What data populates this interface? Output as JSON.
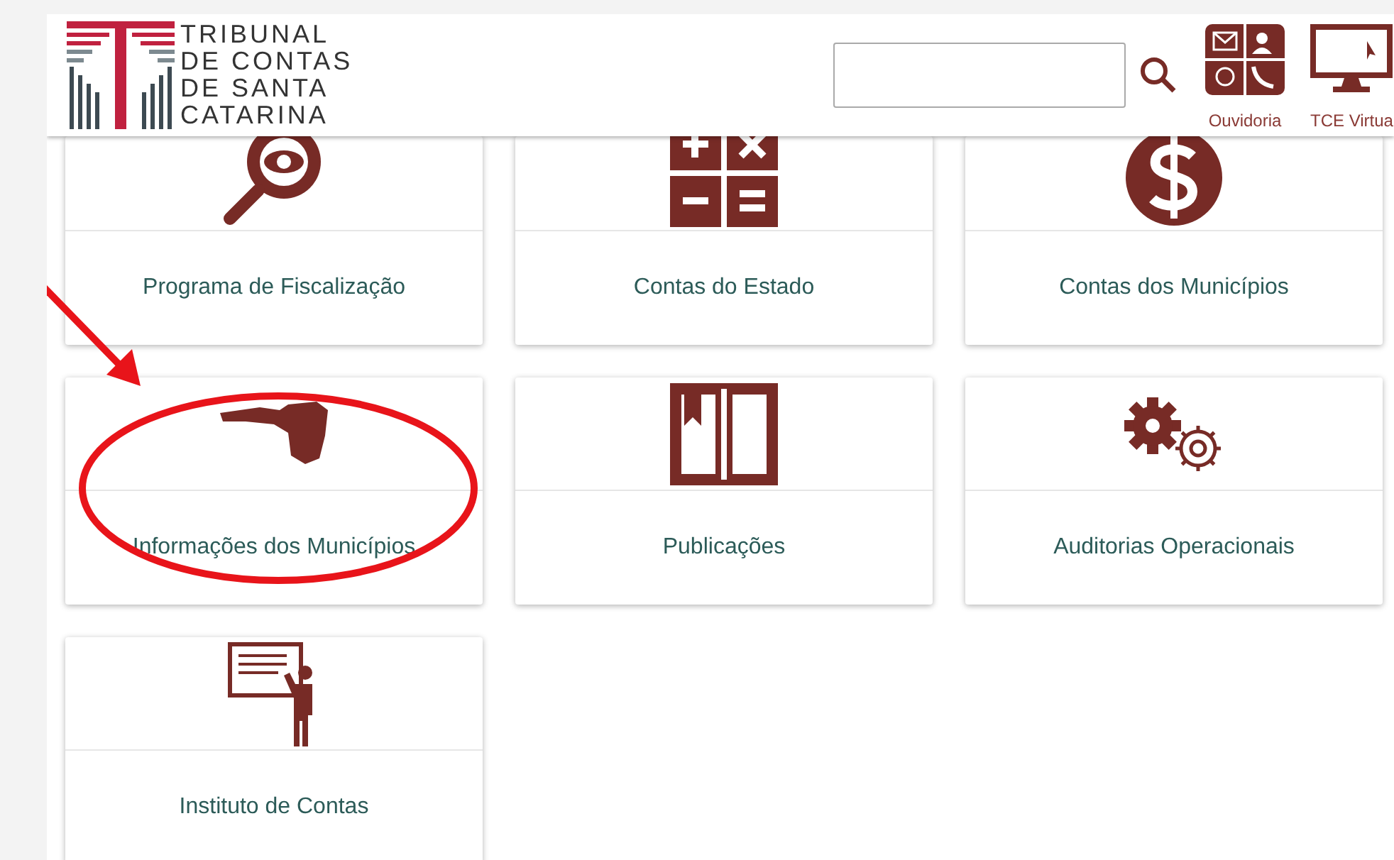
{
  "header": {
    "logo_lines": [
      "TRIBUNAL",
      "DE CONTAS",
      "DE SANTA",
      "CATARINA"
    ],
    "shortcuts": [
      {
        "label": "Ouvidoria"
      },
      {
        "label": "TCE Virtua"
      }
    ]
  },
  "cards": [
    {
      "label": "Programa de Fiscalização"
    },
    {
      "label": "Contas do Estado"
    },
    {
      "label": "Contas dos Municípios"
    },
    {
      "label": "Informações dos Municípios"
    },
    {
      "label": "Publicações"
    },
    {
      "label": "Auditorias Operacionais"
    },
    {
      "label": "Instituto de Contas"
    }
  ]
}
